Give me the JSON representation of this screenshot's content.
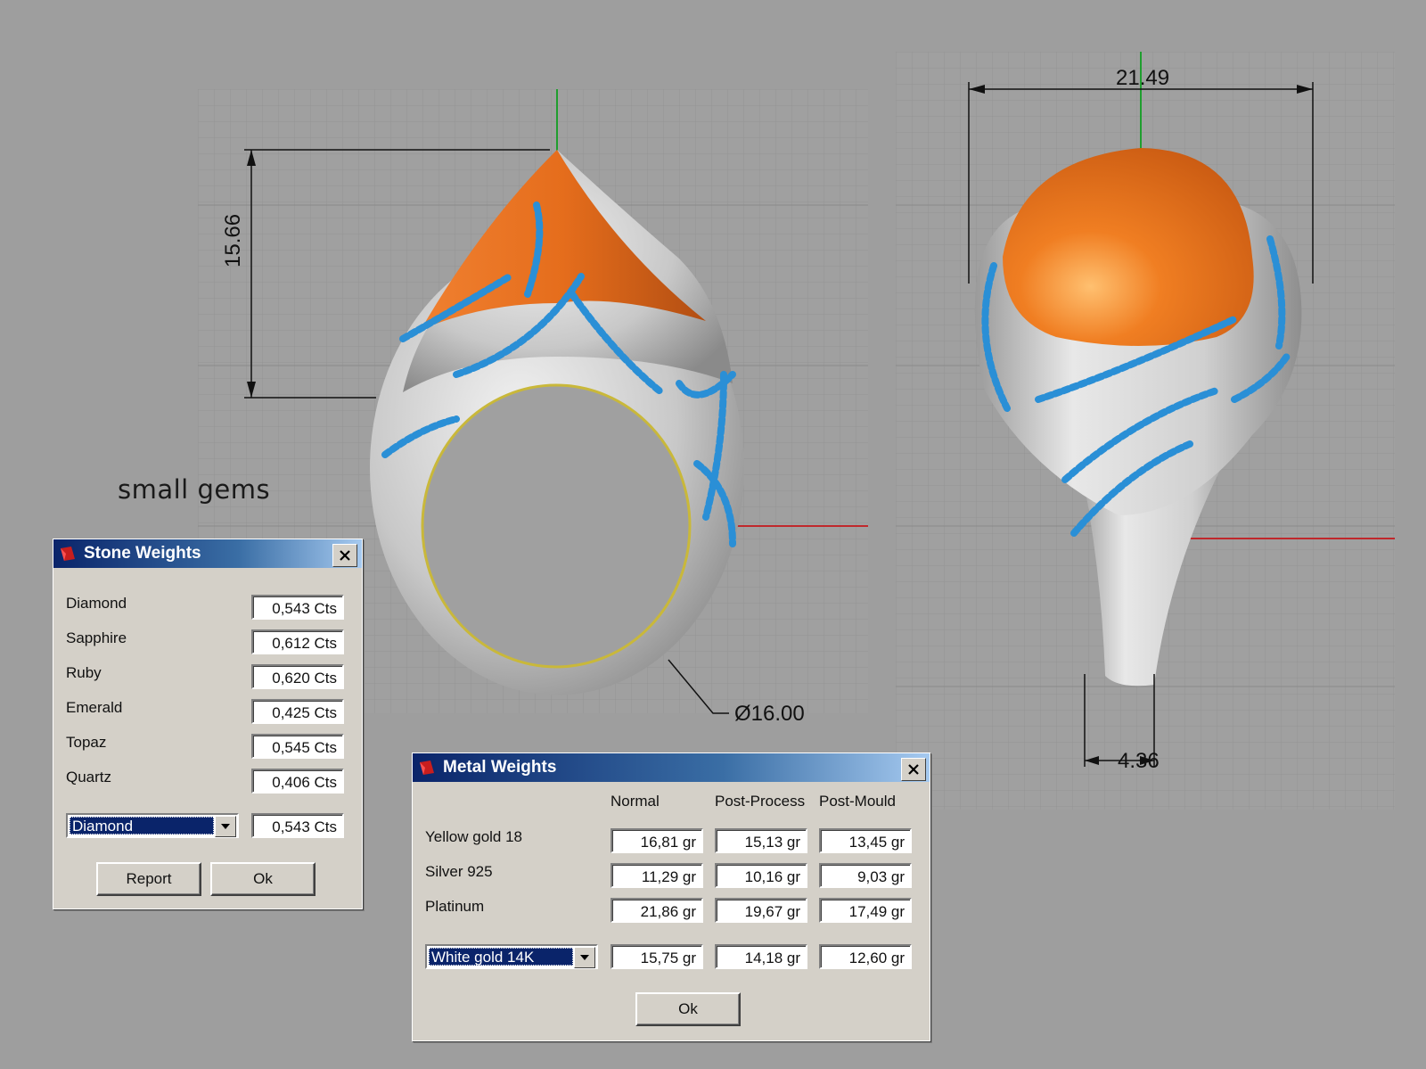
{
  "caption": "small gems",
  "dimensions": {
    "height": "15.66",
    "width": "21.49",
    "diameter": "Ø16.00",
    "shank": "4.36"
  },
  "colors": {
    "stone": "#e8731e",
    "gems": "#2a8fd6",
    "metal": "#d8d8d8",
    "title_start": "#0a246a",
    "title_end": "#a6caf0"
  },
  "stone_dialog": {
    "title": "Stone Weights",
    "rows": [
      {
        "label": "Diamond",
        "value": "0,543 Cts"
      },
      {
        "label": "Sapphire",
        "value": "0,612 Cts"
      },
      {
        "label": "Ruby",
        "value": "0,620 Cts"
      },
      {
        "label": "Emerald",
        "value": "0,425 Cts"
      },
      {
        "label": "Topaz",
        "value": "0,545 Cts"
      },
      {
        "label": "Quartz",
        "value": "0,406 Cts"
      }
    ],
    "select_value": "Diamond",
    "select_result": "0,543 Cts",
    "report_label": "Report",
    "ok_label": "Ok"
  },
  "metal_dialog": {
    "title": "Metal Weights",
    "columns": [
      "Normal",
      "Post-Process",
      "Post-Mould"
    ],
    "rows": [
      {
        "label": "Yellow gold 18",
        "values": [
          "16,81 gr",
          "15,13 gr",
          "13,45 gr"
        ]
      },
      {
        "label": "Silver 925",
        "values": [
          "11,29 gr",
          "10,16 gr",
          "9,03 gr"
        ]
      },
      {
        "label": "Platinum",
        "values": [
          "21,86 gr",
          "19,67 gr",
          "17,49 gr"
        ]
      }
    ],
    "select_value": "White gold 14K",
    "select_values": [
      "15,75 gr",
      "14,18 gr",
      "12,60 gr"
    ],
    "ok_label": "Ok"
  }
}
